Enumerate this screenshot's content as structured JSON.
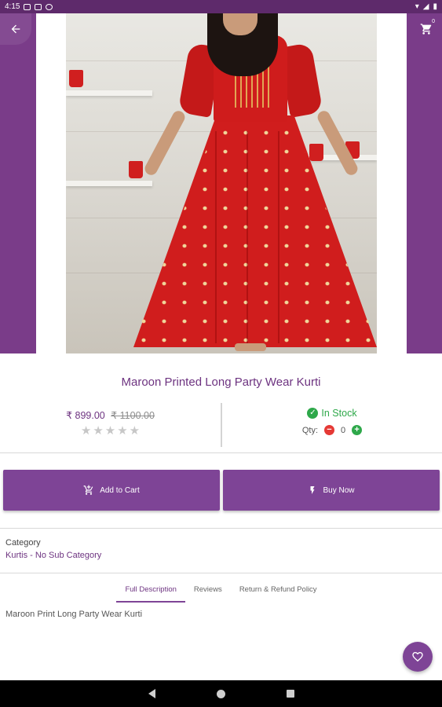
{
  "status_bar": {
    "time": "4:15"
  },
  "header": {
    "back_icon": "arrow-left-icon",
    "cart_icon": "cart-icon",
    "cart_count": "0"
  },
  "product": {
    "title": "Maroon Printed Long Party Wear Kurti",
    "price": "₹ 899.00",
    "old_price": "₹ 1100.00",
    "rating": 0,
    "rating_max": 5,
    "stock_status": "In Stock",
    "qty_label": "Qty:",
    "qty_value": "0"
  },
  "actions": {
    "add_to_cart": "Add to Cart",
    "buy_now": "Buy Now"
  },
  "category": {
    "label": "Category",
    "value": "Kurtis - No Sub Category"
  },
  "tabs": [
    {
      "label": "Full Description",
      "active": true
    },
    {
      "label": "Reviews",
      "active": false
    },
    {
      "label": "Return & Refund Policy",
      "active": false
    }
  ],
  "description": "Maroon Print Long  Party Wear Kurti",
  "colors": {
    "primary": "#7e4496",
    "dark": "#5e2a6b",
    "title": "#6d3380",
    "success": "#2ea84a",
    "danger": "#e53935"
  }
}
